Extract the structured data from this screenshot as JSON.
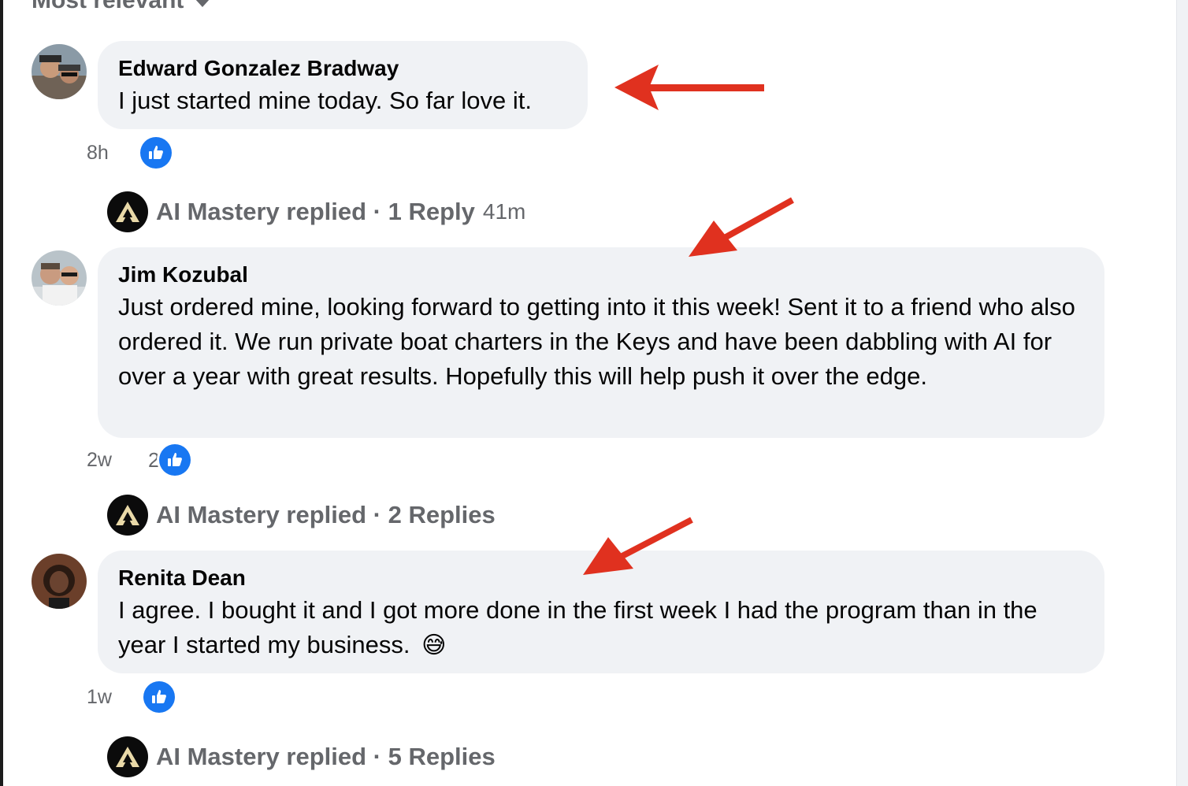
{
  "sort": {
    "label": "Most relevant"
  },
  "comments": [
    {
      "author": "Edward Gonzalez Bradway",
      "text": "I just started mine today. So far love it.",
      "time": "8h",
      "like_count": "",
      "reply": {
        "text": "AI Mastery replied · 1 Reply",
        "time": "41m"
      }
    },
    {
      "author": "Jim Kozubal",
      "text": "Just ordered mine, looking forward to getting into it this week! Sent it to a friend who also ordered it. We run private boat charters in the Keys and have been dabbling with AI for over a year with great results. Hopefully this will help push it over the edge.",
      "time": "2w",
      "like_count": "2",
      "reply": {
        "text": "AI Mastery replied · 2 Replies",
        "time": ""
      }
    },
    {
      "author": "Renita Dean",
      "text": "I agree. I bought it and I got more done in the first week I had the program than in the year I started my business.",
      "emoji": "😅",
      "time": "1w",
      "like_count": "",
      "reply": {
        "text": "AI Mastery replied · 5 Replies",
        "time": ""
      }
    }
  ],
  "colors": {
    "bubble": "#f0f2f5",
    "like_blue": "#1877f2",
    "muted_text": "#65676b",
    "arrow_red": "#e0311f"
  },
  "icons": {
    "like": "thumbs-up-icon",
    "page_logo": "ai-mastery-logo-icon",
    "annotation": "red-arrow-annotation"
  }
}
